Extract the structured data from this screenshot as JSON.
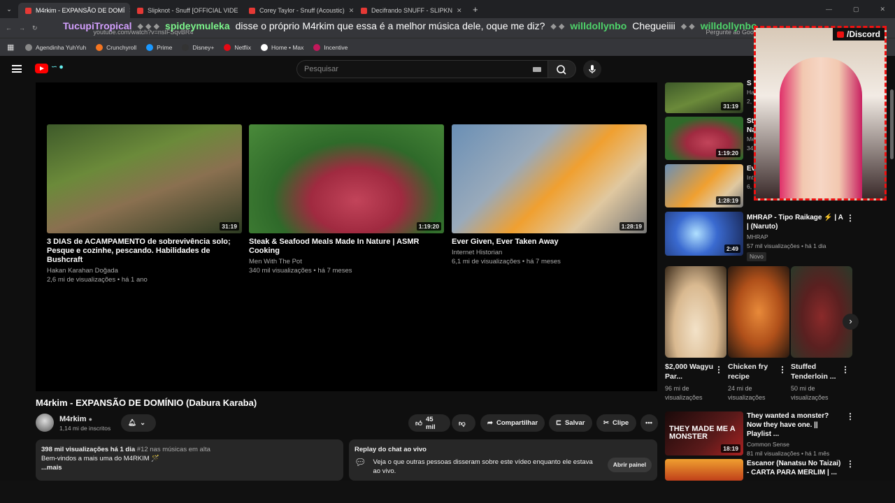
{
  "tabs": [
    {
      "label": "M4rkim - EXPANSÃO DE DOMÍ"
    },
    {
      "label": "Slipknot - Snuff [OFFICIAL VIDE"
    },
    {
      "label": "Corey Taylor - Snuff (Acoustic)"
    },
    {
      "label": "Decifrando SNUFF - SLIPKN"
    }
  ],
  "address": {
    "url": "youtube.com/watch?v=nsIFSqvBR4",
    "google_hint": "Pergunte ao Google"
  },
  "chat_overlay": {
    "user1": "TucupiTropical",
    "user2": "spideymuleka",
    "message2": "disse o próprio M4rkim que essa é a melhor música dele, oque me diz?",
    "user3": "willdollynbo",
    "message3": "Chegueiiii",
    "user4": "willdollynbo"
  },
  "bookmarks": [
    {
      "label": "Agendinha YuhYuh"
    },
    {
      "label": "Crunchyroll"
    },
    {
      "label": "Prime"
    },
    {
      "label": "Disney+"
    },
    {
      "label": "Netflix"
    },
    {
      "label": "Home • Max"
    },
    {
      "label": "Incentive"
    }
  ],
  "search": {
    "placeholder": "Pesquisar"
  },
  "end_cards": [
    {
      "title": "3 DIAS de ACAMPAMENTO de sobrevivência solo; Pesque e cozinhe, pescando. Habilidades de Bushcraft",
      "channel": "Hakan Karahan Doğada",
      "meta": "2,6 mi de visualizações • há 1 ano",
      "duration": "31:19"
    },
    {
      "title": "Steak & Seafood Meals Made In Nature | ASMR Cooking",
      "channel": "Men With The Pot",
      "meta": "340 mil visualizações • há 7 meses",
      "duration": "1:19:20"
    },
    {
      "title": "Ever Given, Ever Taken Away",
      "channel": "Internet Historian",
      "meta": "6,1 mi de visualizações • há 7 meses",
      "duration": "1:28:19"
    }
  ],
  "video": {
    "title": "M4rkim - EXPANSÃO DE DOMÍNIO (Dabura Karaba)",
    "channel": "M4rkim",
    "subscribers": "1,14 mi de inscritos",
    "likes": "45 mil",
    "share_label": "Compartilhar",
    "save_label": "Salvar",
    "clip_label": "Clipe",
    "views_line": "398 mil visualizações  há 1 dia",
    "trending": "#12 nas músicas em alta",
    "description": "Bem-vindos a mais uma do M4RKIM 🪄",
    "more": "...mais"
  },
  "chat_replay": {
    "title": "Replay do chat ao vivo",
    "text": "Veja o que outras pessoas disseram sobre este vídeo enquanto ele estava ao vivo.",
    "button": "Abrir painel"
  },
  "sidebar": {
    "items": [
      {
        "duration": "31:19",
        "title_frag": "S",
        "channel_frag": "Ha",
        "meta_frag": "2,"
      },
      {
        "duration": "1:19:20",
        "title_frag": "St",
        "title_frag2": "Na",
        "channel_frag": "Me",
        "meta_frag": "34"
      },
      {
        "duration": "1:28:19",
        "title_frag": "Ev",
        "channel_frag": "Int",
        "meta_frag": "6,"
      },
      {
        "duration": "2:49",
        "title": "MHRAP - Tipo Raikage ⚡ | A | (Naruto)",
        "channel": "MHRAP",
        "meta": "57 mil visualizações • há 1 dia",
        "badge": "Novo"
      }
    ],
    "shorts": [
      {
        "title": "$2,000 Wagyu Par...",
        "meta": "96 mi de visualizações"
      },
      {
        "title": "Chicken fry recipe",
        "meta": "24 mi de visualizações"
      },
      {
        "title": "Stuffed Tenderloin ...",
        "meta": "50 mi de visualizações"
      }
    ],
    "more_items": [
      {
        "duration": "18:19",
        "thumb_text": "THEY MADE ME A MONSTER",
        "title": "They wanted a monster? Now they have one. || Playlist ...",
        "channel": "Common Sense",
        "meta": "81 mil visualizações • há 1 mês"
      },
      {
        "title": "Escanor (Nanatsu No Taizai) - CARTA PARA MERLIM | ..."
      }
    ]
  },
  "overlay": {
    "discord_label": "/Discord"
  }
}
